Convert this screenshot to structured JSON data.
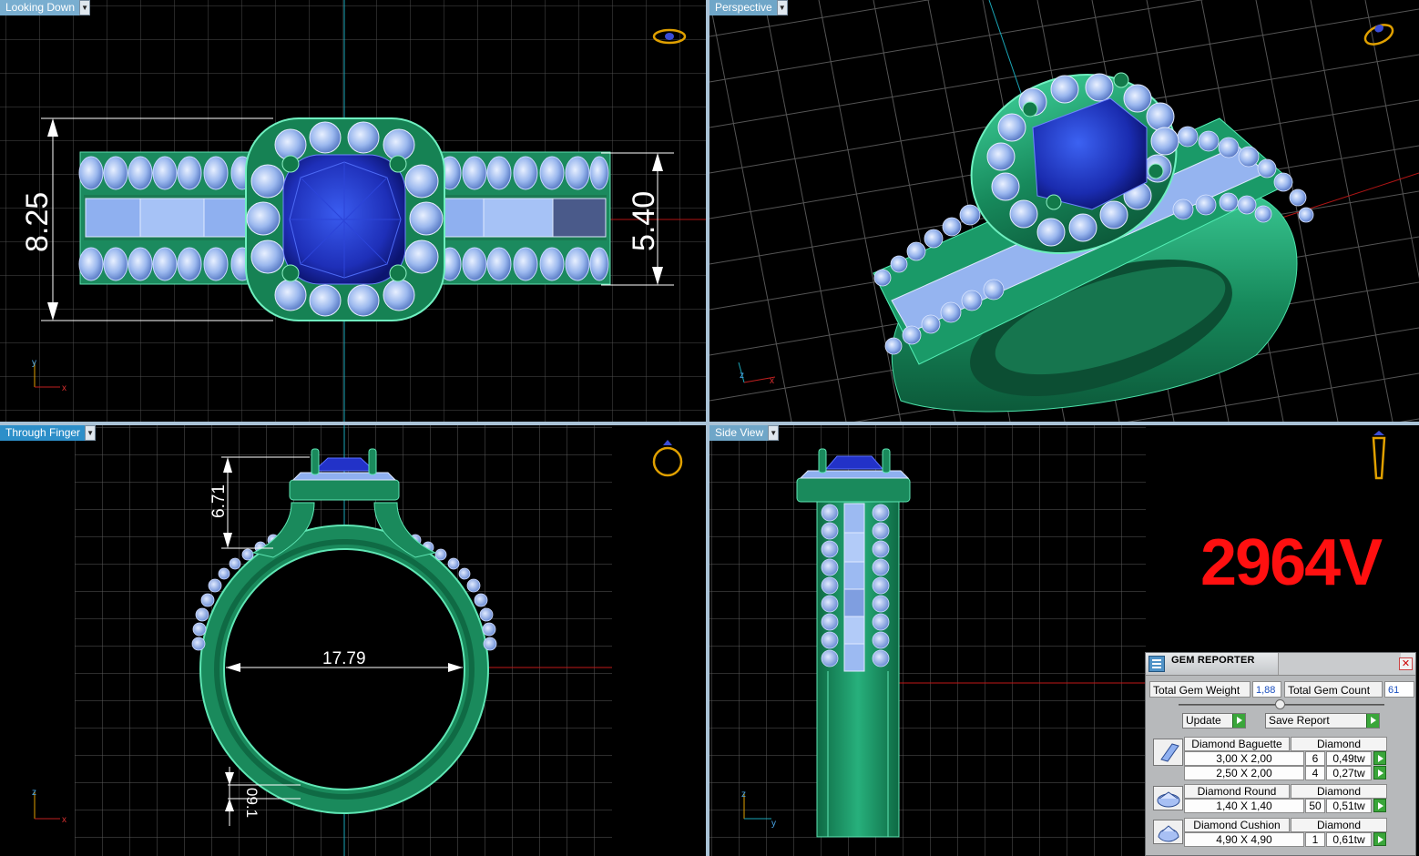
{
  "viewports": {
    "top_left": {
      "label": "Looking Down",
      "dim_height": "8.25",
      "dim_inner": "5.40"
    },
    "top_right": {
      "label": "Perspective"
    },
    "bottom_left": {
      "label": "Through Finger",
      "dim_height": "6.71",
      "dim_width": "17.79",
      "dim_small": "09.1"
    },
    "bottom_right": {
      "label": "Side View"
    }
  },
  "axes": {
    "x": "x",
    "y": "y",
    "z": "z"
  },
  "model_number": "2964V",
  "gem_reporter": {
    "title": "GEM REPORTER",
    "total_weight_label": "Total Gem Weight",
    "total_weight_value": "1,88",
    "total_count_label": "Total Gem Count",
    "total_count_value": "61",
    "update_label": "Update",
    "save_report_label": "Save Report",
    "groups": [
      {
        "name": "Diamond Baguette",
        "material": "Diamond",
        "icon": "baguette-gem-icon",
        "rows": [
          {
            "size": "3,00 X 2,00",
            "count": "6",
            "weight": "0,49tw"
          },
          {
            "size": "2,50 X 2,00",
            "count": "4",
            "weight": "0,27tw"
          }
        ]
      },
      {
        "name": "Diamond Round",
        "material": "Diamond",
        "icon": "round-gem-icon",
        "rows": [
          {
            "size": "1,40 X 1,40",
            "count": "50",
            "weight": "0,51tw"
          }
        ]
      },
      {
        "name": "Diamond Cushion",
        "material": "Diamond",
        "icon": "cushion-gem-icon",
        "rows": [
          {
            "size": "4,90 X 4,90",
            "count": "1",
            "weight": "0,61tw"
          }
        ]
      }
    ]
  },
  "colors": {
    "metal": "#1f9a6a",
    "center_stone": "#2a3fd0",
    "diamonds": "#9dbaf0",
    "grid": "#5a5a5a",
    "model_number": "#ff1010"
  }
}
